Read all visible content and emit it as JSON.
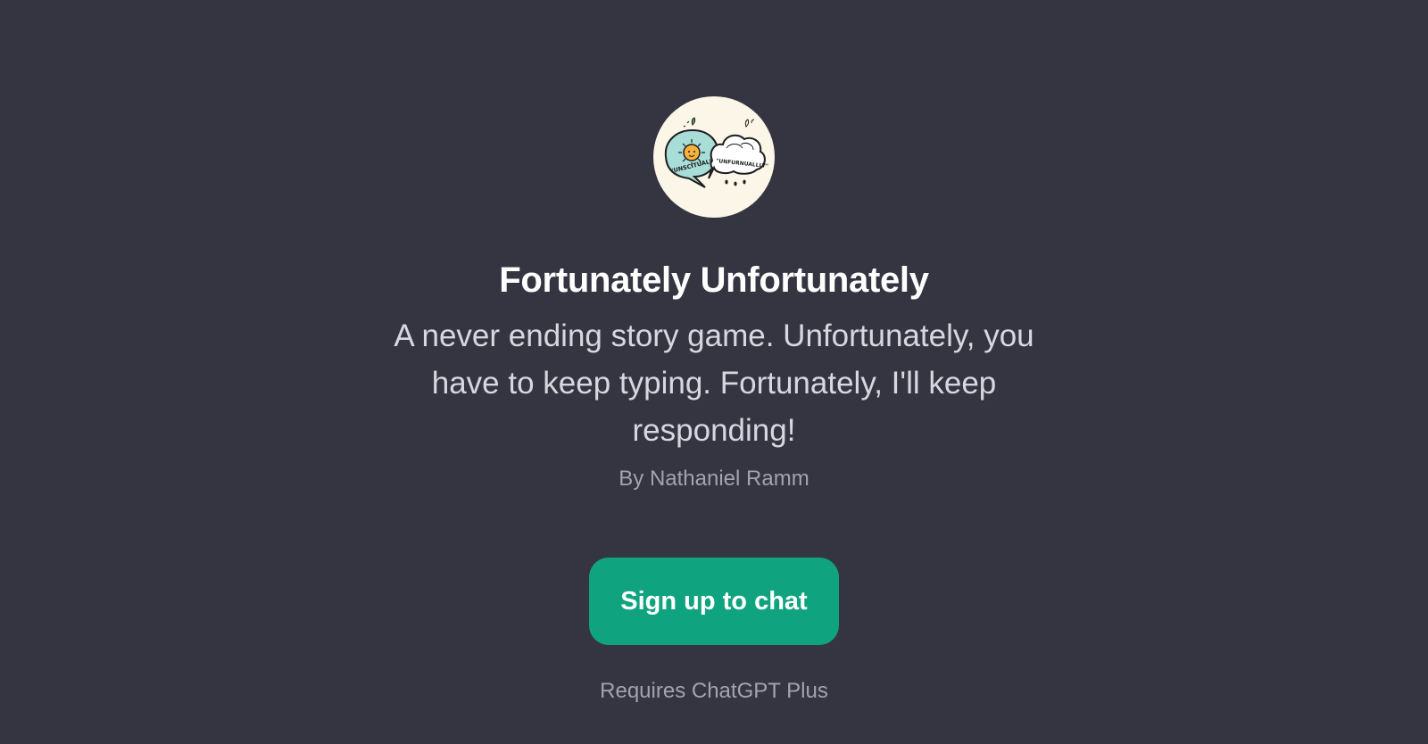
{
  "gpt": {
    "avatar_icon": "speech-bubbles-sun-cloud-logo",
    "logo_text_left": "\"UNSCITUALLY\"",
    "logo_text_right": "\"UNFURNUALLLY\"",
    "title": "Fortunately Unfortunately",
    "description": "A never ending story game. Unfortunately, you have to keep typing. Fortunately, I'll keep responding!",
    "author": "By Nathaniel Ramm"
  },
  "cta": {
    "label": "Sign up to chat",
    "color": "#10a37f"
  },
  "footer": {
    "requires": "Requires ChatGPT Plus"
  },
  "theme": {
    "background": "#343541"
  }
}
